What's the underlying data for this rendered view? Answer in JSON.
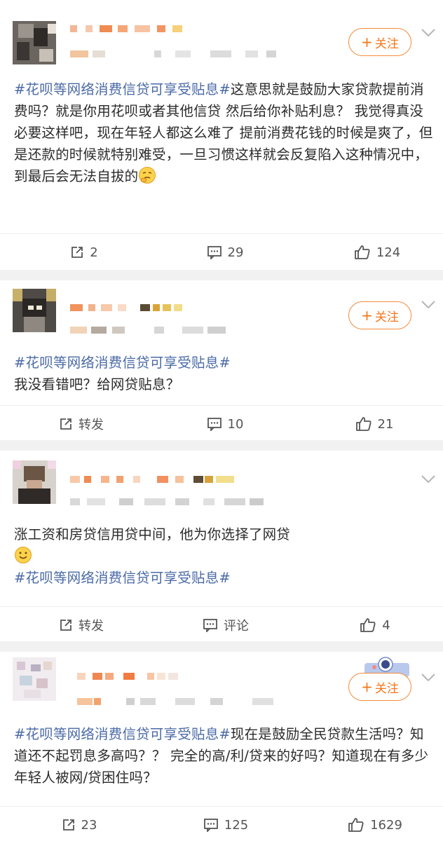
{
  "posts": [
    {
      "follow_label": "关注",
      "hashtag": "#花呗等网络消费信贷可享受贴息#",
      "text_after_tag": "这意思就是鼓励大家贷款提前消费吗？就是你用花呗或者其他信贷 然后给你补贴利息？ 我觉得真没必要这样吧，现在年轻人都这么难了 提前消费花钱的时候是爽了，但是还款的时候就特别难受，一旦习惯这样就会反复陷入这种情况中，到最后会无法自拔的",
      "emoji": "thinking-face-emoji",
      "repost": "2",
      "comments": "29",
      "likes": "124"
    },
    {
      "follow_label": "关注",
      "hashtag": "#花呗等网络消费信贷可享受贴息#",
      "text": "我没看错吧？给网贷贴息？",
      "repost": "转发",
      "comments": "10",
      "likes": "21"
    },
    {
      "text": "涨工资和房贷信用贷中间，他为你选择了网贷",
      "emoji": "smile-emoji",
      "hashtag": "#花呗等网络消费信贷可享受贴息#",
      "repost": "转发",
      "comments": "评论",
      "likes": "4"
    },
    {
      "follow_label": "关注",
      "hashtag": "#花呗等网络消费信贷可享受贴息#",
      "text_after_tag": "现在是鼓励全民贷款生活吗？知道还不起罚息多高吗？？ 完全的高/利/贷来的好吗？知道现在有多少年轻人被网/贷困住吗？",
      "repost": "23",
      "comments": "125",
      "likes": "1629"
    }
  ],
  "colors": {
    "accent_orange": "#f5761a",
    "hashtag_blue": "#4a6aa6",
    "separator_gray": "#f1f1f1"
  },
  "icons": [
    "share-icon",
    "comment-icon",
    "like-icon",
    "chevron-down-icon",
    "plus-icon"
  ]
}
